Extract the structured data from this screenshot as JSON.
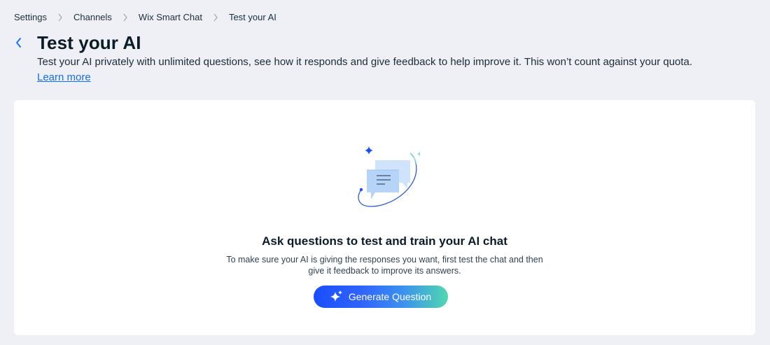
{
  "breadcrumb": {
    "items": [
      "Settings",
      "Channels",
      "Wix Smart Chat"
    ],
    "current": "Test your AI"
  },
  "header": {
    "title": "Test your AI",
    "subtitle": "Test your AI privately with unlimited questions, see how it responds and give feedback to help improve it. This won’t count against your quota.",
    "learn_more": "Learn more"
  },
  "empty_state": {
    "illustration": "chat-bubbles-sparkle-icon",
    "title": "Ask questions to test and train your AI chat",
    "description_line1": "To make sure your AI is giving the responses you want, first test the chat and then",
    "description_line2": "give it feedback to improve its answers.",
    "button_label": "Generate Question"
  },
  "colors": {
    "accent": "#116dff",
    "background": "#eef0f5",
    "card": "#ffffff"
  }
}
